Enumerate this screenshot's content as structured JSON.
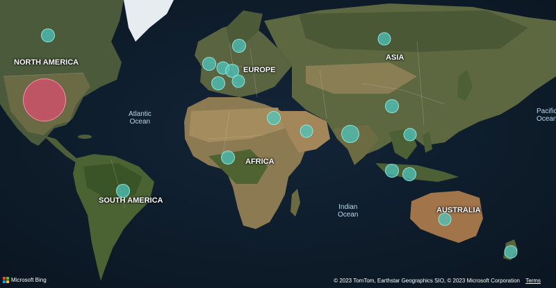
{
  "map": {
    "continents": [
      {
        "id": "north-america",
        "label": "NORTH AMERICA"
      },
      {
        "id": "europe",
        "label": "EUROPE"
      },
      {
        "id": "asia",
        "label": "ASIA"
      },
      {
        "id": "africa",
        "label": "AFRICA"
      },
      {
        "id": "south-america",
        "label": "SOUTH AMERICA"
      },
      {
        "id": "australia",
        "label": "AUSTRALIA"
      }
    ],
    "oceans": [
      {
        "id": "atlantic",
        "line1": "Atlantic",
        "line2": "Ocean"
      },
      {
        "id": "indian",
        "line1": "Indian",
        "line2": "Ocean"
      },
      {
        "id": "pacific",
        "line1": "Pacific",
        "line2": "Ocean"
      }
    ],
    "bubble_colors": {
      "default": "#4ec9c0",
      "highlight": "#d6506e"
    },
    "bubble_count": 24
  },
  "footer": {
    "logo_text": "Microsoft Bing",
    "attribution": "© 2023 TomTom, Earthstar Geographics SIO, © 2023 Microsoft Corporation",
    "terms": "Terms"
  }
}
